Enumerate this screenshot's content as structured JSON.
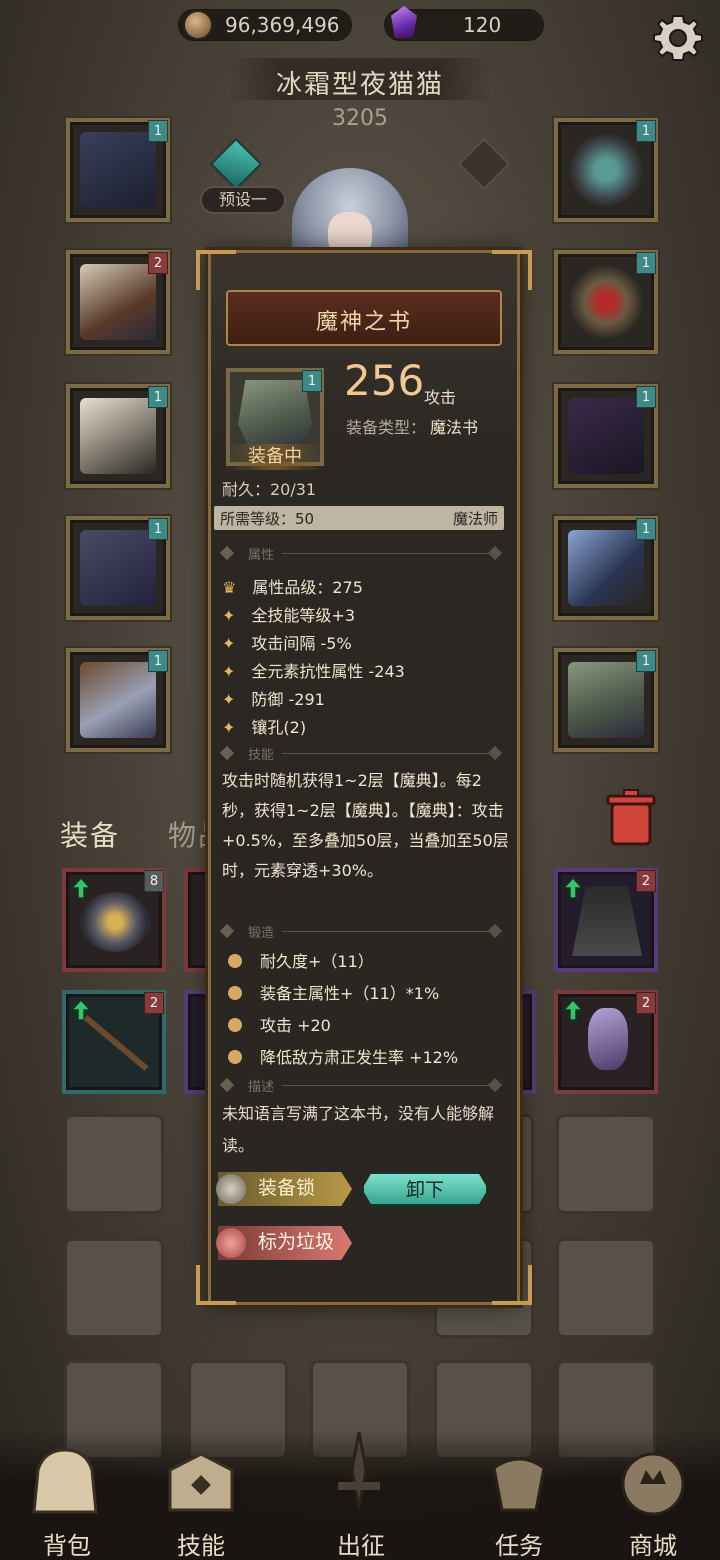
{
  "currency": {
    "coins": "96,369,496",
    "gems": "120"
  },
  "character": {
    "name": "冰霜型夜猫猫",
    "score": "3205"
  },
  "preset": {
    "label": "预设一"
  },
  "tabs": {
    "equipment": "装备",
    "items": "物品"
  },
  "item": {
    "name": "魔神之书",
    "tier": "1",
    "equipped_label": "装备中",
    "attack_value": "256",
    "attack_unit": "攻击",
    "type_label": "装备类型：",
    "type_value": "魔法书",
    "durability": "耐久：20/31",
    "required_level": "所需等级：50",
    "class": "魔法师",
    "sections": {
      "attributes": "属性",
      "skill": "技能",
      "forge": "锻造",
      "description": "描述"
    },
    "attributes": [
      "属性品级：275",
      "全技能等级+3",
      "攻击间隔 -5%",
      "全元素抗性属性 -243",
      "防御 -291",
      "镶孔(2)"
    ],
    "skill_text": "攻击时随机获得1~2层【魔典】。每2秒，获得1~2层【魔典】。【魔典】：攻击+0.5%，至多叠加50层，当叠加至50层时，元素穿透+30%。",
    "forge": [
      "耐久度+（11）",
      "装备主属性+（11）*1%",
      "攻击 +20",
      "降低敌方肃正发生率 +12%"
    ],
    "flavor": "未知语言写满了这本书，没有人能够解读。",
    "buttons": {
      "lock": "装备锁",
      "unequip": "卸下",
      "trash": "标为垃圾"
    }
  },
  "equipment_tiers": {
    "left": [
      "1",
      "2",
      "1",
      "1",
      "1"
    ],
    "right": [
      "1",
      "1",
      "1",
      "1",
      "1"
    ]
  },
  "inventory_tiers": [
    "8",
    "2",
    "2",
    "2"
  ],
  "nav": [
    {
      "label": "背包",
      "icon": "backpack-icon"
    },
    {
      "label": "技能",
      "icon": "skill-book-icon"
    },
    {
      "label": "出征",
      "icon": "sword-icon"
    },
    {
      "label": "任务",
      "icon": "quest-icon"
    },
    {
      "label": "商城",
      "icon": "shop-icon"
    }
  ],
  "colors": {
    "accent": "#f2c890",
    "teal": "#3f8a86",
    "frame": "#8a6a3c"
  }
}
